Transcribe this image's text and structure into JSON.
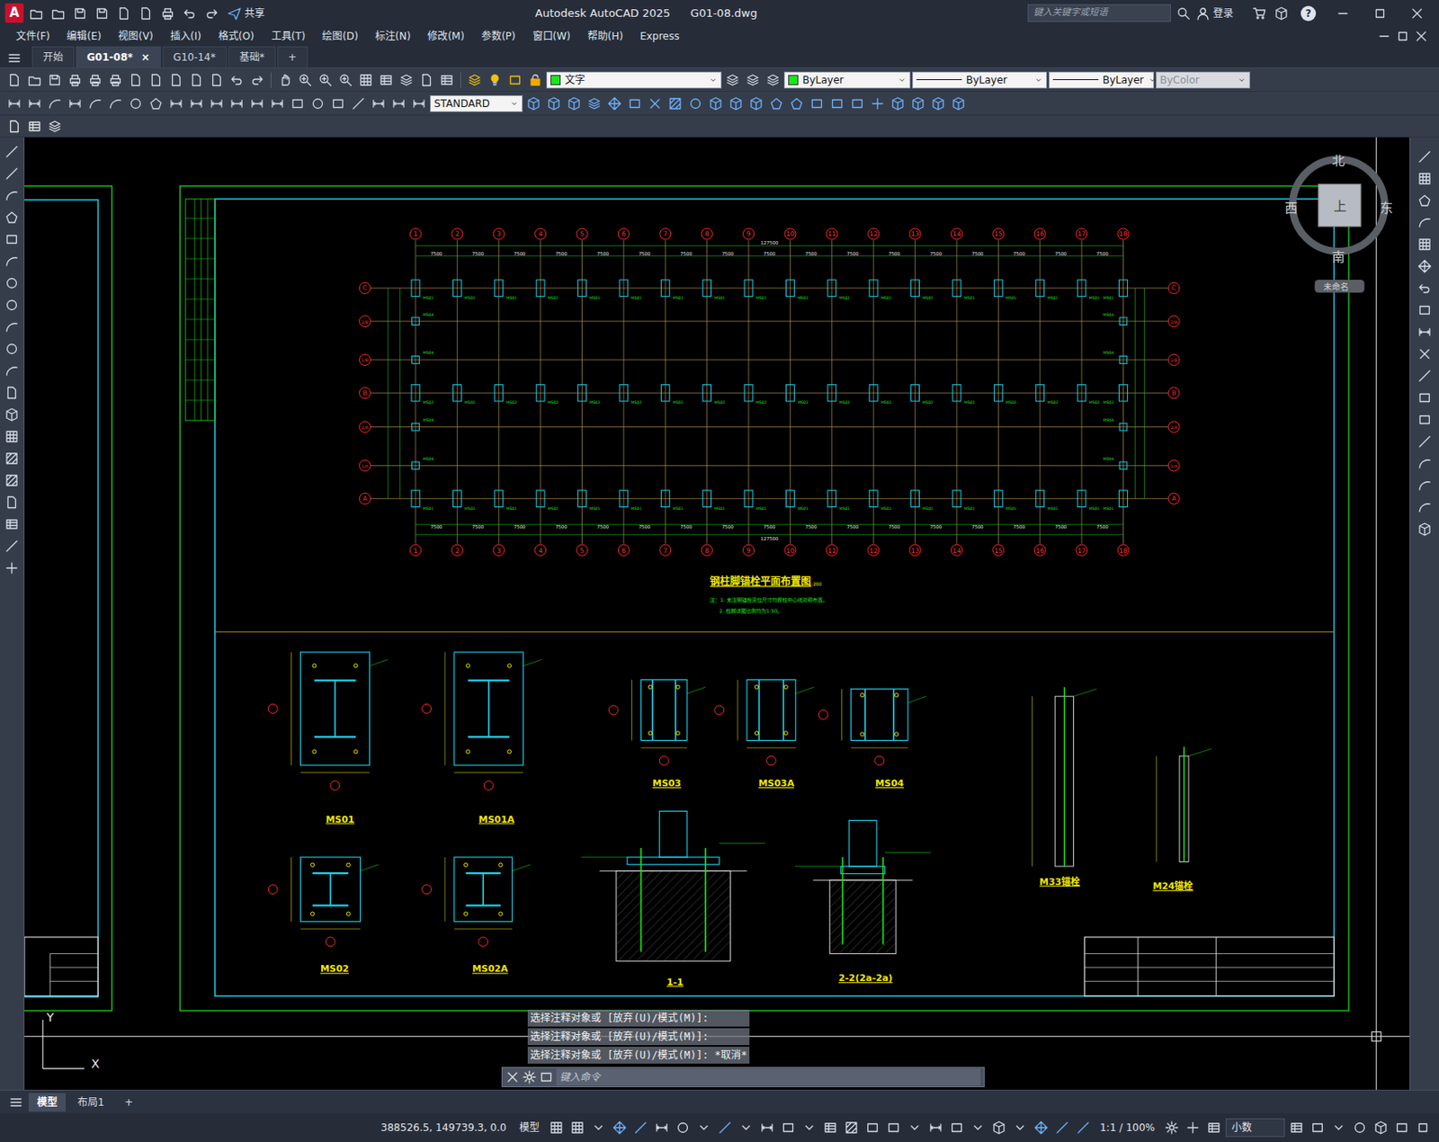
{
  "window": {
    "logo": "A",
    "share": "共享",
    "app": "Autodesk AutoCAD 2025",
    "file": "G01-08.dwg",
    "search_placeholder": "键入关键字或短语",
    "login": "登录",
    "help": "?"
  },
  "menu": [
    "文件(F)",
    "编辑(E)",
    "视图(V)",
    "插入(I)",
    "格式(O)",
    "工具(T)",
    "绘图(D)",
    "标注(N)",
    "修改(M)",
    "参数(P)",
    "窗口(W)",
    "帮助(H)",
    "Express"
  ],
  "doc_tabs": [
    {
      "label": "开始",
      "selected": false
    },
    {
      "label": "G01-08*",
      "selected": true,
      "close": "×"
    },
    {
      "label": "G10-14*",
      "selected": false
    },
    {
      "label": "基础*",
      "selected": false
    }
  ],
  "new_tab": "+",
  "toolbar": {
    "layer": "文字",
    "color": "ByLayer",
    "linetype": "ByLayer",
    "lineweight": "ByLayer",
    "plotstyle": "ByColor",
    "plotstyle_disabled": true,
    "textstyle": "STANDARD"
  },
  "viewcube": {
    "north": "北",
    "south": "南",
    "east": "东",
    "west": "西",
    "face": "上",
    "ucs": "未命名"
  },
  "plan": {
    "columns": [
      "1",
      "2",
      "3",
      "4",
      "5",
      "6",
      "7",
      "8",
      "9",
      "10",
      "11",
      "12",
      "13",
      "14",
      "15",
      "16",
      "17",
      "18"
    ],
    "rows": [
      "C",
      "2/B",
      "1/B",
      "B",
      "2/A",
      "1/A",
      "A"
    ],
    "marks": [
      "MS01",
      "MS04",
      "MS04",
      "MS02",
      "MS04",
      "MS04",
      "MS01"
    ],
    "spacing": "7500",
    "total": "127500",
    "title": "钢柱脚锚栓平面布置图",
    "scale": "1:200",
    "notes": [
      "注：1. 未注明锚栓定位尺寸均按柱中心线对称布置。",
      "2. 柱脚详图比例均为1:50。"
    ]
  },
  "details": [
    {
      "label": "MS01"
    },
    {
      "label": "MS01A"
    },
    {
      "label": "MS03"
    },
    {
      "label": "MS03A"
    },
    {
      "label": "MS04"
    },
    {
      "label": "MS02"
    },
    {
      "label": "MS02A"
    },
    {
      "label": "1-1"
    },
    {
      "label": "2-2(2a-2a)"
    },
    {
      "label": "M33锚栓"
    },
    {
      "label": "M24锚栓"
    }
  ],
  "ucs": {
    "x": "X",
    "y": "Y"
  },
  "command": {
    "history": [
      "选择注释对象或 [放弃(U)/模式(M)]:",
      "选择注释对象或 [放弃(U)/模式(M)]:",
      "选择注释对象或 [放弃(U)/模式(M)]: *取消*"
    ],
    "placeholder": "键入命令"
  },
  "layout_tabs": [
    {
      "label": "模型",
      "selected": true
    },
    {
      "label": "布局1",
      "selected": false
    }
  ],
  "new_layout": "+",
  "status": {
    "coords": "388526.5, 149739.3, 0.0",
    "space": "模型",
    "scale": "1:1 / 100%",
    "units": "小数"
  }
}
